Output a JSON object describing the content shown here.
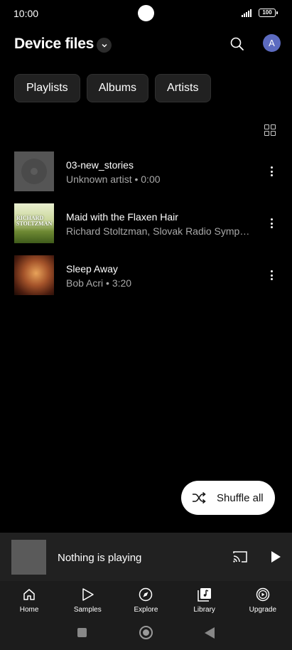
{
  "status_bar": {
    "time": "10:00",
    "battery": "100",
    "icons": [
      "signal-icon",
      "battery-icon"
    ]
  },
  "header": {
    "title": "Device files",
    "dropdown_icon": "chevron-down-icon",
    "search_icon": "search-icon",
    "avatar_initial": "A"
  },
  "chips": [
    {
      "label": "Playlists"
    },
    {
      "label": "Albums"
    },
    {
      "label": "Artists"
    }
  ],
  "view_toggle_icon": "grid-view-icon",
  "songs": [
    {
      "title": "03-new_stories",
      "subtitle": "Unknown artist • 0:00",
      "art": "default-disc-art"
    },
    {
      "title": "Maid with the Flaxen Hair",
      "subtitle": "Richard Stoltzman, Slovak Radio Symph…",
      "art": "album-cover-art",
      "art_text": [
        "RICHARD",
        "STOLTZMAN"
      ]
    },
    {
      "title": "Sleep Away",
      "subtitle": "Bob Acri • 3:20",
      "art": "album-cover-art"
    }
  ],
  "shuffle": {
    "label": "Shuffle all",
    "icon": "shuffle-icon"
  },
  "mini_player": {
    "title": "Nothing is playing",
    "cast_icon": "cast-icon",
    "play_icon": "play-icon"
  },
  "bottom_nav": [
    {
      "label": "Home",
      "icon": "home-icon"
    },
    {
      "label": "Samples",
      "icon": "samples-icon"
    },
    {
      "label": "Explore",
      "icon": "compass-icon"
    },
    {
      "label": "Library",
      "icon": "library-icon"
    },
    {
      "label": "Upgrade",
      "icon": "upgrade-icon"
    }
  ],
  "colors": {
    "background": "#000000",
    "surface": "#212121",
    "nav": "#1c1c1c",
    "avatar": "#5c6bc0",
    "secondary_text": "#a8a8a8"
  }
}
